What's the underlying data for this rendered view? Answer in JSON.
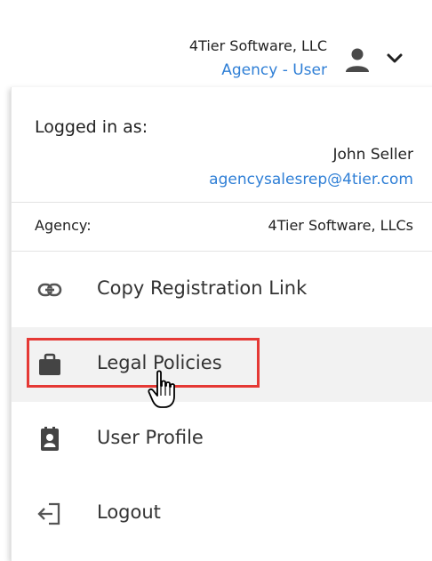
{
  "header": {
    "company": "4Tier Software, LLC",
    "role": "Agency - User",
    "user_icon": "person-icon",
    "chevron_icon": "chevron-down-icon"
  },
  "menu": {
    "logged_in_label": "Logged in as:",
    "user_name": "John Seller",
    "user_email": "agencysalesrep@4tier.com",
    "agency_label": "Agency:",
    "agency_value": "4Tier Software, LLCs",
    "items": [
      {
        "label": "Copy Registration Link",
        "icon": "link-icon"
      },
      {
        "label": "Legal Policies",
        "icon": "briefcase-icon",
        "hovered": true
      },
      {
        "label": "User Profile",
        "icon": "contact-card-icon"
      },
      {
        "label": "Logout",
        "icon": "logout-icon"
      }
    ]
  },
  "annotation": {
    "highlight_color": "#e53935"
  },
  "colors": {
    "accent": "#2f7fd6",
    "hover_bg": "#f2f2f2"
  }
}
